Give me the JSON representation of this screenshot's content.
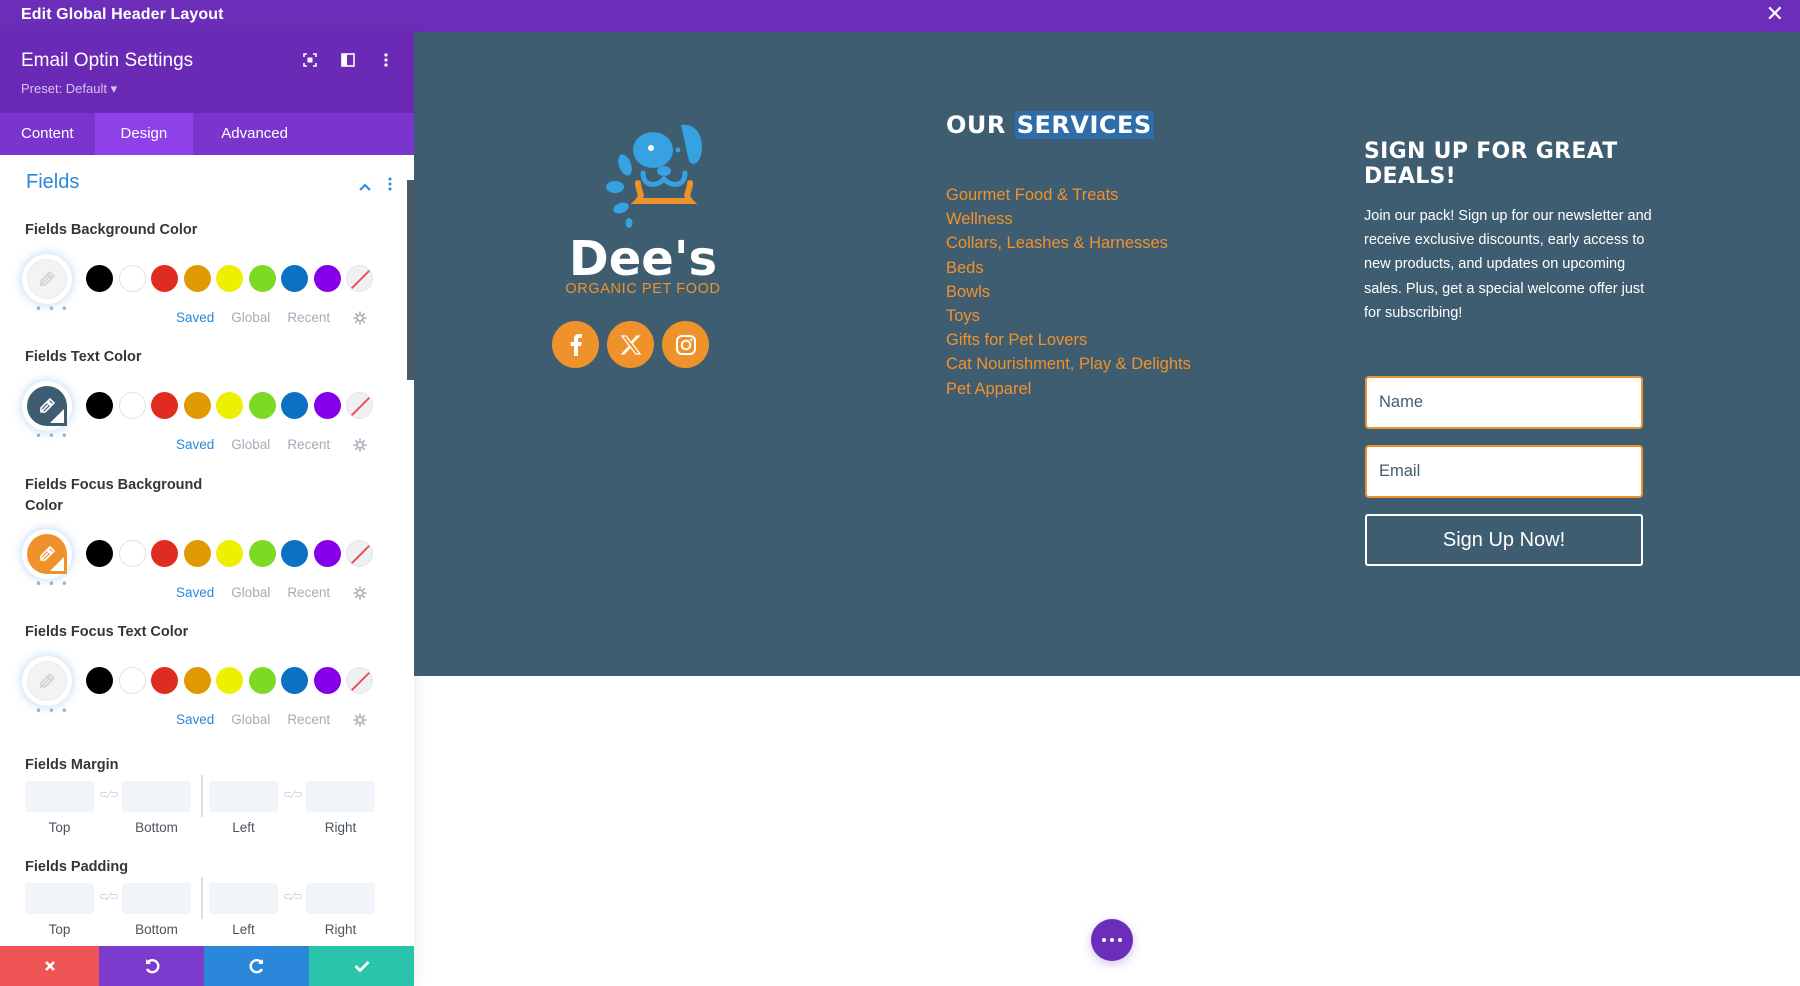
{
  "topbar": {
    "title": "Edit Global Header Layout",
    "close_icon": "close-icon"
  },
  "sidebar": {
    "title": "Email Optin Settings",
    "preset": "Preset: Default ▾",
    "header_icons": [
      "focus-mode-icon",
      "split-view-icon",
      "more-vertical-icon"
    ],
    "tabs": [
      {
        "label": "Content",
        "active": false
      },
      {
        "label": "Design",
        "active": true
      },
      {
        "label": "Advanced",
        "active": false
      }
    ],
    "section_title": "Fields",
    "swatch_colors": [
      "#000000",
      "#ffffff",
      "#e02b20",
      "#e09900",
      "#edf000",
      "#7cda24",
      "#0c71c3",
      "#8300e9",
      "none"
    ],
    "color_settings": [
      {
        "label": "Fields Background Color",
        "value": "",
        "saved": "Saved",
        "global": "Global",
        "recent": "Recent"
      },
      {
        "label": "Fields Text Color",
        "value": "#3f5d71",
        "saved": "Saved",
        "global": "Global",
        "recent": "Recent"
      },
      {
        "label": "Fields Focus Background Color",
        "value": "#f0922b",
        "saved": "Saved",
        "global": "Global",
        "recent": "Recent"
      },
      {
        "label": "Fields Focus Text Color",
        "value": "",
        "saved": "Saved",
        "global": "Global",
        "recent": "Recent"
      }
    ],
    "spacing_settings": [
      {
        "label": "Fields Margin",
        "sides": [
          "Top",
          "Bottom",
          "Left",
          "Right"
        ],
        "values": [
          "",
          "",
          "",
          ""
        ]
      },
      {
        "label": "Fields Padding",
        "sides": [
          "Top",
          "Bottom",
          "Left",
          "Right"
        ],
        "values": [
          "",
          "",
          "",
          ""
        ]
      }
    ],
    "bottom_actions": [
      "cancel",
      "undo",
      "redo",
      "save"
    ]
  },
  "canvas": {
    "logo": {
      "name": "Dee's",
      "tagline": "ORGANIC PET FOOD"
    },
    "social": [
      "facebook",
      "x",
      "instagram"
    ],
    "services": {
      "title_a": "OUR ",
      "title_b": "SERVICES",
      "items": [
        "Gourmet Food & Treats",
        "Wellness",
        "Collars, Leashes & Harnesses",
        "Beds",
        "Bowls",
        "Toys",
        "Gifts for Pet Lovers",
        "Cat Nourishment, Play & Delights",
        "Pet Apparel"
      ]
    },
    "signup": {
      "title": "SIGN UP FOR GREAT DEALS!",
      "text": "Join our pack! Sign up for our newsletter and receive exclusive discounts, early access to new products, and updates on upcoming sales. Plus, get a special welcome offer just for subscribing!",
      "name_placeholder": "Name",
      "email_placeholder": "Email",
      "button": "Sign Up Now!"
    }
  },
  "colors": {
    "builder_purple": "#6c2eb9",
    "accent_blue": "#2b87da",
    "brand_orange": "#f0922b",
    "brand_slate": "#3f5d71"
  }
}
